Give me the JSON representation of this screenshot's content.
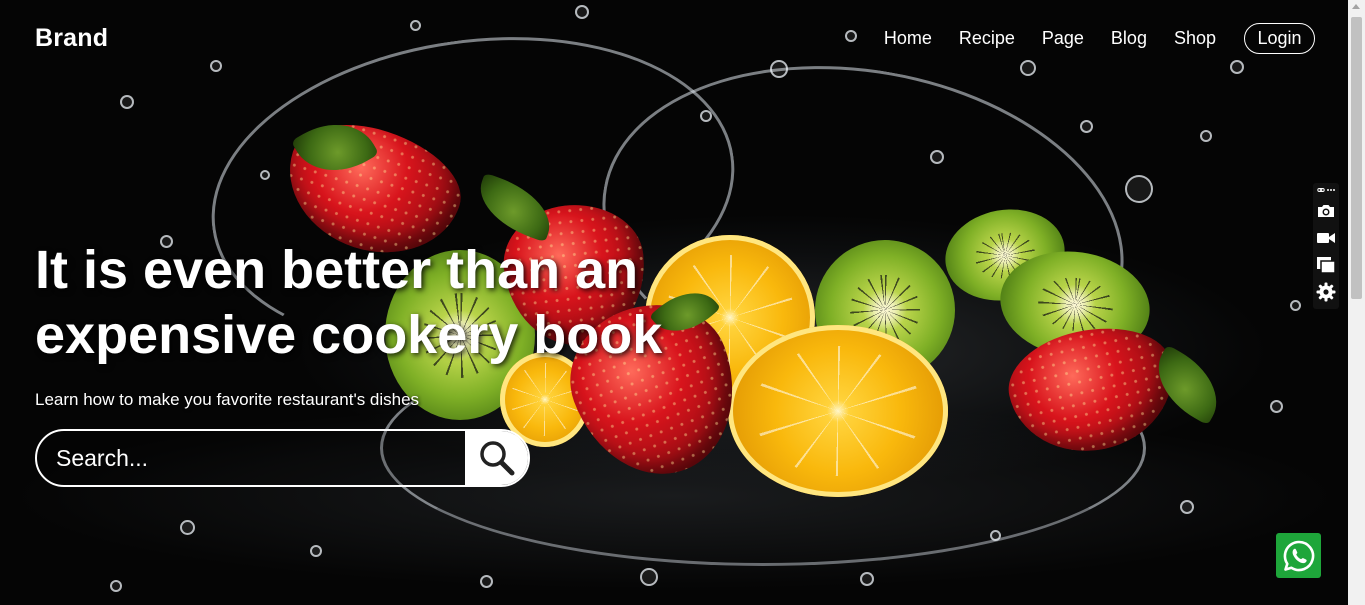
{
  "navbar": {
    "brand": "Brand",
    "links": [
      "Home",
      "Recipe",
      "Page",
      "Blog",
      "Shop"
    ],
    "login_label": "Login"
  },
  "hero": {
    "title_line1": "It is even better than an",
    "title_line2": "expensive cookery book",
    "subtitle": "Learn how to make you favorite restaurant's dishes",
    "background_image": "fruit-water-splash-image"
  },
  "search": {
    "placeholder": "Search...",
    "button_icon": "search-icon"
  },
  "floating_toolbar": {
    "icons": [
      "link-icon",
      "more-icon",
      "camera-icon",
      "video-camera-icon",
      "copy-window-icon",
      "gear-icon"
    ]
  },
  "whatsapp": {
    "icon": "whatsapp-icon",
    "color": "#1ea63a"
  },
  "colors": {
    "text": "#ffffff",
    "background": "#000000"
  }
}
